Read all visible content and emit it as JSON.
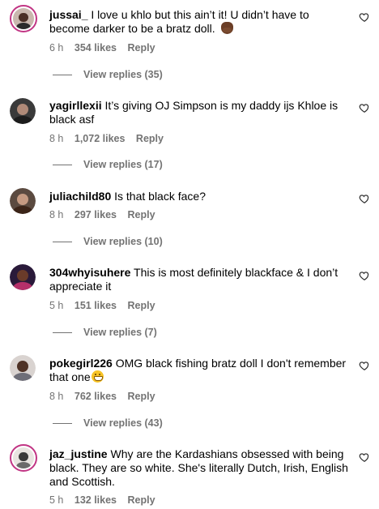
{
  "comments": [
    {
      "username": "jussai_",
      "text": "I love u khlo but this ain’t it! U didn’t have to become darker to be a bratz doll.",
      "emoji": "facepalm",
      "time": "6 h",
      "likes": "354 likes",
      "reply": "Reply",
      "view_replies": "View replies (35)",
      "avatar_colors": {
        "bg": "#c9b7ae",
        "head": "#4a2e25",
        "body": "#2b2b2b"
      },
      "has_story_ring": true
    },
    {
      "username": "yagirllexii",
      "text": "It’s giving OJ Simpson is my daddy ijs Khloe is black asf",
      "time": "8 h",
      "likes": "1,072 likes",
      "reply": "Reply",
      "view_replies": "View replies (17)",
      "avatar_colors": {
        "bg": "#3a3a3a",
        "head": "#b08a78",
        "body": "#1c1c1c"
      },
      "has_story_ring": false
    },
    {
      "username": "juliachild80",
      "text": "Is that black face?",
      "time": "8 h",
      "likes": "297 likes",
      "reply": "Reply",
      "view_replies": "View replies (10)",
      "avatar_colors": {
        "bg": "#5b4a40",
        "head": "#c59a82",
        "body": "#3b2418"
      },
      "has_story_ring": false
    },
    {
      "username": "304whyisuhere",
      "text": "This is most definitely blackface & I don’t appreciate it",
      "time": "5 h",
      "likes": "151 likes",
      "reply": "Reply",
      "view_replies": "View replies (7)",
      "avatar_colors": {
        "bg": "#2a1a3a",
        "head": "#6a3b2a",
        "body": "#b5306a"
      },
      "has_story_ring": false
    },
    {
      "username": "pokegirl226",
      "text": "OMG black fishing bratz doll I don't remember that one",
      "emoji": "grin",
      "time": "8 h",
      "likes": "762 likes",
      "reply": "Reply",
      "view_replies": "View replies (43)",
      "avatar_colors": {
        "bg": "#d9d3d0",
        "head": "#4e3226",
        "body": "#6e6e78"
      },
      "has_story_ring": false
    },
    {
      "username": "jaz_justine",
      "text": "Why are the Kardashians obsessed with being black. They are so white. She's literally Dutch, Irish, English and Scottish.",
      "time": "5 h",
      "likes": "132 likes",
      "reply": "Reply",
      "avatar_colors": {
        "bg": "#e8e4e0",
        "head": "#3a3a3a",
        "body": "#6a6a6a"
      },
      "has_story_ring": true
    }
  ]
}
